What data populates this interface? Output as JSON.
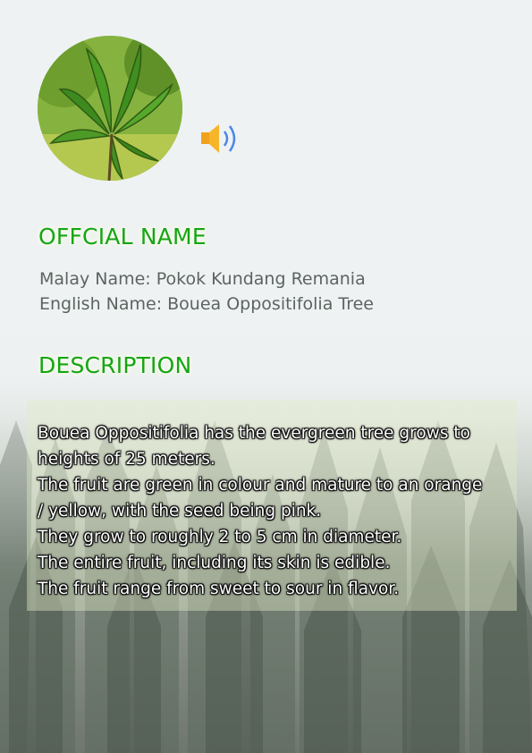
{
  "official_heading": "OFFCIAL NAME",
  "names": {
    "malay": "Malay Name: Pokok Kundang Remania",
    "english": "English Name: Bouea Oppositifolia Tree"
  },
  "description_heading": "DESCRIPTION",
  "description_lines": [
    "Bouea Oppositifolia has the evergreen tree grows to",
    "heights of 25 meters.",
    "The fruit are green in colour and mature to an orange",
    "/ yellow, with the seed being pink.",
    "They grow to roughly 2 to 5 cm in diameter.",
    "The entire fruit, including its skin is edible.",
    "The fruit range from sweet to sour in flavor."
  ],
  "icons": {
    "plant_photo": "leaves-photo",
    "audio": "speaker-icon"
  },
  "colors": {
    "heading": "#14a614",
    "name_text": "#5c6460",
    "description_text": "#ffffff"
  }
}
